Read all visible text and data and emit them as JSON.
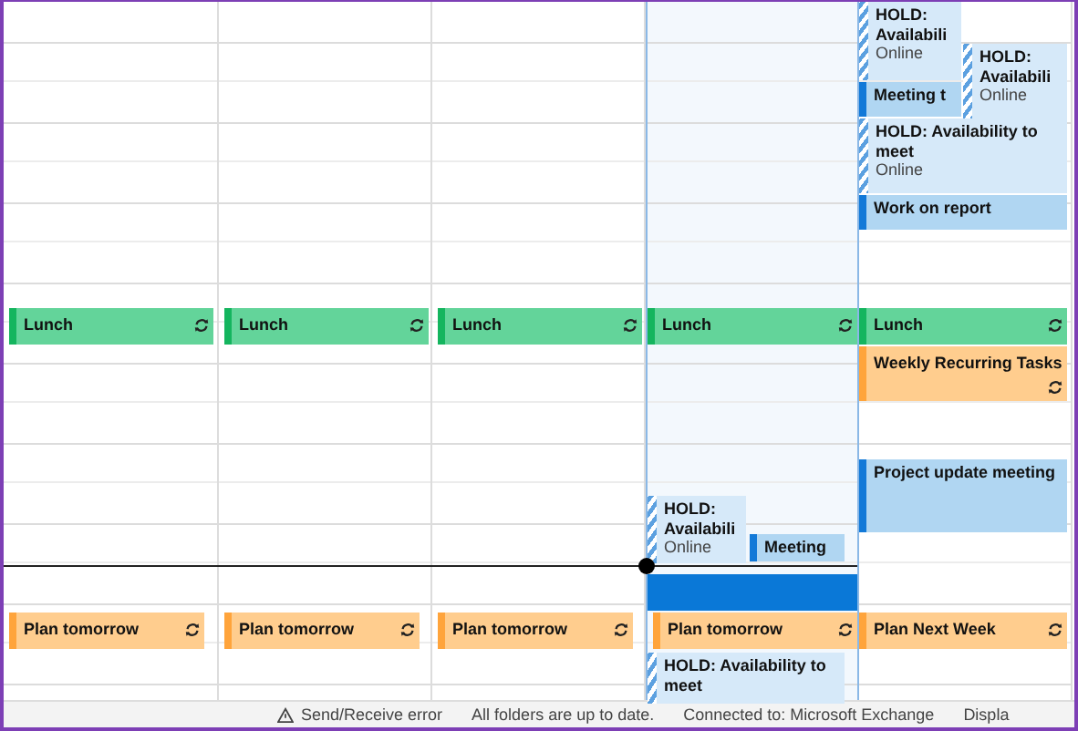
{
  "days": [
    {
      "today": false,
      "events": [
        {
          "kind": "lunch",
          "title": "Lunch",
          "recurring": true
        },
        {
          "kind": "task",
          "title": "Plan tomorrow",
          "recurring": true
        }
      ]
    },
    {
      "today": false,
      "events": [
        {
          "kind": "lunch",
          "title": "Lunch",
          "recurring": true
        },
        {
          "kind": "task",
          "title": "Plan tomorrow",
          "recurring": true
        }
      ]
    },
    {
      "today": false,
      "events": [
        {
          "kind": "lunch",
          "title": "Lunch",
          "recurring": true
        },
        {
          "kind": "task",
          "title": "Plan tomorrow",
          "recurring": true
        }
      ]
    },
    {
      "today": true,
      "events": [
        {
          "kind": "lunch",
          "title": "Lunch",
          "recurring": true
        },
        {
          "kind": "hold",
          "title": "HOLD: Availabili",
          "subtitle": "Online",
          "recurring": false
        },
        {
          "kind": "busy",
          "title": "Meeting",
          "recurring": false
        },
        {
          "kind": "task",
          "title": "Plan tomorrow",
          "recurring": true
        },
        {
          "kind": "hold",
          "title": "HOLD: Availability to meet",
          "recurring": false
        }
      ]
    },
    {
      "today": false,
      "events": [
        {
          "kind": "hold",
          "title": "HOLD: Availabili",
          "subtitle": "Online",
          "recurring": false
        },
        {
          "kind": "busy",
          "title": "Meeting t",
          "recurring": false
        },
        {
          "kind": "hold",
          "title": "HOLD: Availabili",
          "subtitle": "Online",
          "recurring": false
        },
        {
          "kind": "hold",
          "title": "HOLD: Availability to meet",
          "subtitle": "Online",
          "recurring": false
        },
        {
          "kind": "busy",
          "title": "Work on report",
          "recurring": false
        },
        {
          "kind": "lunch",
          "title": "Lunch",
          "recurring": true
        },
        {
          "kind": "task",
          "title": "Weekly Recurring Tasks",
          "recurring": true
        },
        {
          "kind": "busy",
          "title": "Project update meeting",
          "recurring": false
        },
        {
          "kind": "task",
          "title": "Plan Next Week",
          "recurring": true
        }
      ]
    }
  ],
  "status_bar": [
    "Send/Receive error",
    "All folders are up to date.",
    "Connected to: Microsoft Exchange",
    "Displa"
  ]
}
